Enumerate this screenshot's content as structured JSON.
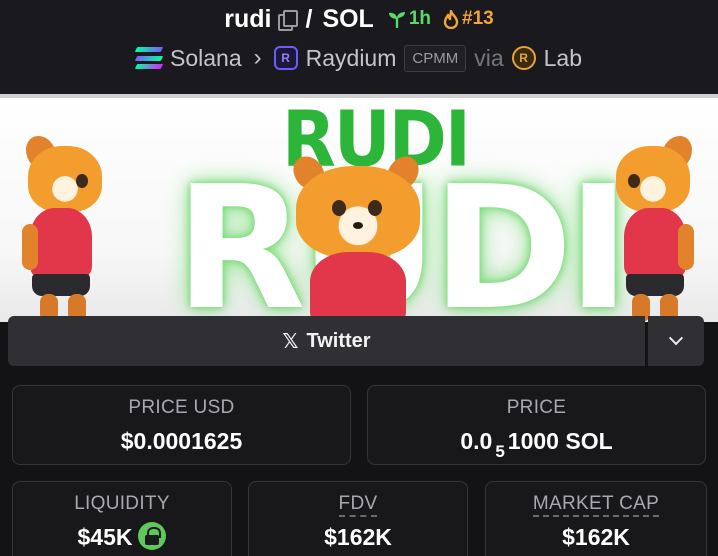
{
  "header": {
    "base_token": "rudi",
    "separator": "/",
    "quote_token": "SOL",
    "age": "1h",
    "rank": "#13",
    "colors": {
      "age": "#5bd96b",
      "rank": "#f4a53a"
    }
  },
  "breadcrumb": {
    "chain": "Solana",
    "dex": "Raydium",
    "pool_type": "CPMM",
    "via": "via",
    "launchpad": "Lab"
  },
  "banner": {
    "logo_small": "RUDI",
    "logo_big": "RUDI"
  },
  "social": {
    "twitter_label": "Twitter",
    "x_glyph": "𝕏"
  },
  "stats": {
    "price_usd": {
      "label": "PRICE USD",
      "value": "$0.0001625"
    },
    "price_native": {
      "label": "PRICE",
      "prefix": "0.0",
      "zeros": "5",
      "rest": "1000 SOL"
    },
    "liquidity": {
      "label": "LIQUIDITY",
      "value": "$45K"
    },
    "fdv": {
      "label": "FDV",
      "value": "$162K"
    },
    "market_cap": {
      "label": "MARKET CAP",
      "value": "$162K"
    }
  }
}
